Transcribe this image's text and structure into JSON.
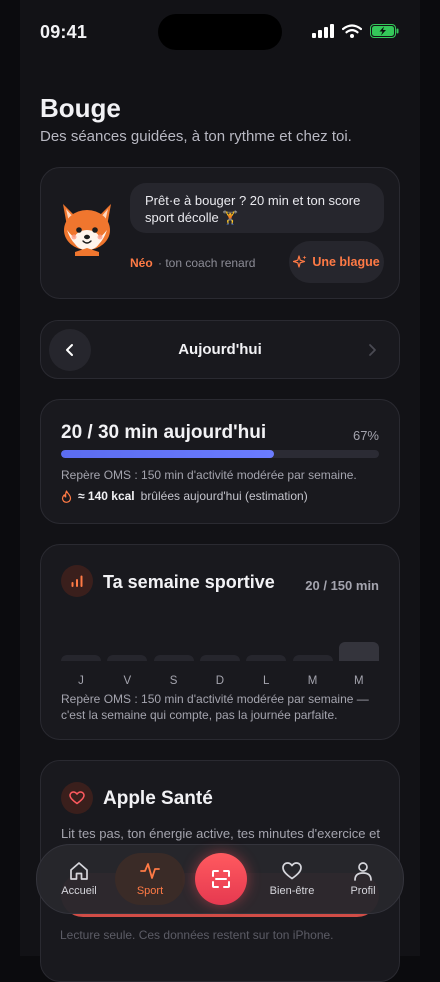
{
  "status": {
    "time": "09:41"
  },
  "header": {
    "title": "Bouge",
    "subtitle": "Des séances guidées, à ton rythme et chez toi."
  },
  "coach": {
    "message": "Prêt·e à bouger ? 20 min et ton score sport décolle 🏋",
    "name": "Néo",
    "role": "· ton coach renard",
    "joke_label": "Une blague",
    "avatar_icon": "fox-icon"
  },
  "day_nav": {
    "label": "Aujourd'hui"
  },
  "progress": {
    "title": "20 / 30 min aujourd'hui",
    "percent_label": "67%",
    "fraction": 0.67,
    "oms_note": "Repère OMS : 150 min d'activité modérée par semaine.",
    "kcal_value": "≈ 140 kcal",
    "kcal_text": "brûlées aujourd'hui (estimation)"
  },
  "week": {
    "title": "Ta semaine sportive",
    "total": "20 / 150 min",
    "days": [
      {
        "letter": "J",
        "level": 0.02
      },
      {
        "letter": "V",
        "level": 0.02
      },
      {
        "letter": "S",
        "level": 0.02
      },
      {
        "letter": "D",
        "level": 0.02
      },
      {
        "letter": "L",
        "level": 0.02
      },
      {
        "letter": "M",
        "level": 0.02
      },
      {
        "letter": "M",
        "level": 0.13
      }
    ],
    "note": "Repère OMS : 150 min d'activité modérée par semaine — c'est la semaine qui compte, pas la journée parfaite."
  },
  "health": {
    "title": "Apple Santé",
    "description": "Lit tes pas, ton énergie active, tes minutes d'exercice et",
    "footer_note": "Lecture seule. Ces données restent sur ton iPhone."
  },
  "tabbar": {
    "items": [
      {
        "label": "Accueil",
        "icon": "home-icon"
      },
      {
        "label": "Sport",
        "icon": "activity-icon"
      },
      {
        "label": "",
        "icon": "scan-icon"
      },
      {
        "label": "Bien-être",
        "icon": "heart-icon"
      },
      {
        "label": "Profil",
        "icon": "user-icon"
      }
    ]
  },
  "colors": {
    "accent": "#ff7a45",
    "progress": "#5b6cf0",
    "scan": "#e63950",
    "background": "#121216"
  }
}
